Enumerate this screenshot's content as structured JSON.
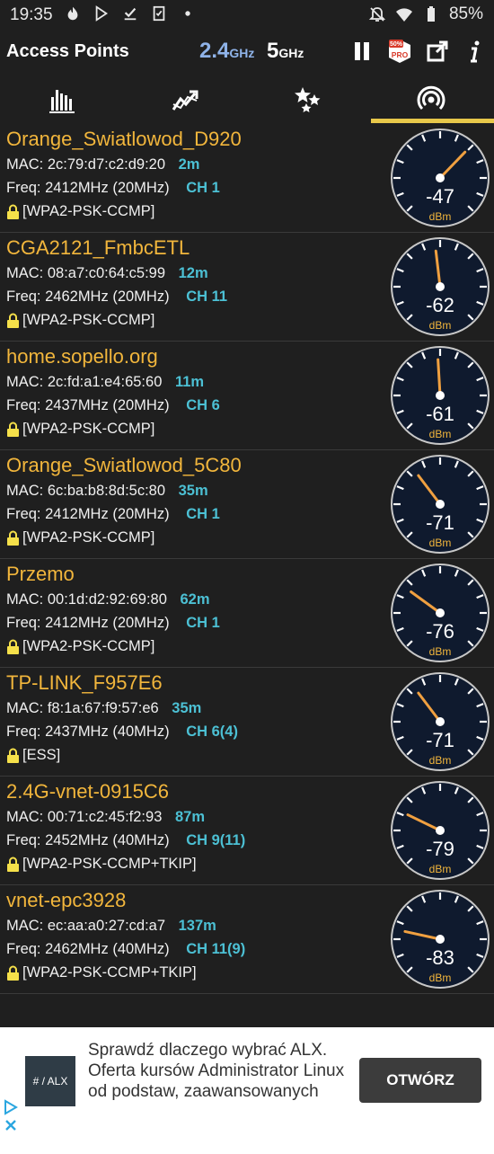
{
  "status_bar": {
    "time": "19:35",
    "battery": "85%",
    "icons_left": [
      "phoenix-icon",
      "play-store-icon",
      "download-done-icon",
      "clipboard-check-icon",
      "dot-icon"
    ],
    "icons_right": [
      "notifications-off-icon",
      "wifi-5-icon",
      "battery-icon"
    ]
  },
  "toolbar": {
    "title": "Access Points",
    "band_24": "2.4",
    "band_24_unit": "GHz",
    "band_5": "5",
    "band_5_unit": "GHz",
    "pro_badge": "50%",
    "pro_label": "PRO",
    "actions": [
      "pause-icon",
      "pro-icon",
      "share-icon",
      "info-icon"
    ]
  },
  "tabs": [
    {
      "name": "channel-rating",
      "icon": "bar-chart-icon"
    },
    {
      "name": "time-graph",
      "icon": "trend-icon"
    },
    {
      "name": "channel-graph",
      "icon": "stars-icon"
    },
    {
      "name": "access-points",
      "icon": "signal-icon",
      "selected": true
    }
  ],
  "access_points": [
    {
      "ssid": "Orange_Swiatlowod_D920",
      "mac_label": "MAC:",
      "mac": "2c:79:d7:c2:d9:20",
      "distance": "2m",
      "freq_label": "Freq:",
      "freq": "2412MHz",
      "width": "(20MHz)",
      "channel": "CH 1",
      "security": "[WPA2-PSK-CCMP]",
      "dbm": "-47",
      "level": -47
    },
    {
      "ssid": "CGA2121_FmbcETL",
      "mac_label": "MAC:",
      "mac": "08:a7:c0:64:c5:99",
      "distance": "12m",
      "freq_label": "Freq:",
      "freq": "2462MHz",
      "width": "(20MHz)",
      "channel": "CH 11",
      "security": "[WPA2-PSK-CCMP]",
      "dbm": "-62",
      "level": -62
    },
    {
      "ssid": "home.sopello.org",
      "mac_label": "MAC:",
      "mac": "2c:fd:a1:e4:65:60",
      "distance": "11m",
      "freq_label": "Freq:",
      "freq": "2437MHz",
      "width": "(20MHz)",
      "channel": "CH 6",
      "security": "[WPA2-PSK-CCMP]",
      "dbm": "-61",
      "level": -61
    },
    {
      "ssid": "Orange_Swiatlowod_5C80",
      "mac_label": "MAC:",
      "mac": "6c:ba:b8:8d:5c:80",
      "distance": "35m",
      "freq_label": "Freq:",
      "freq": "2412MHz",
      "width": "(20MHz)",
      "channel": "CH 1",
      "security": "[WPA2-PSK-CCMP]",
      "dbm": "-71",
      "level": -71
    },
    {
      "ssid": "Przemo",
      "mac_label": "MAC:",
      "mac": "00:1d:d2:92:69:80",
      "distance": "62m",
      "freq_label": "Freq:",
      "freq": "2412MHz",
      "width": "(20MHz)",
      "channel": "CH 1",
      "security": "[WPA2-PSK-CCMP]",
      "dbm": "-76",
      "level": -76
    },
    {
      "ssid": "TP-LINK_F957E6",
      "mac_label": "MAC:",
      "mac": "f8:1a:67:f9:57:e6",
      "distance": "35m",
      "freq_label": "Freq:",
      "freq": "2437MHz",
      "width": "(40MHz)",
      "channel": "CH 6(4)",
      "security": "[ESS]",
      "dbm": "-71",
      "level": -71
    },
    {
      "ssid": "2.4G-vnet-0915C6",
      "mac_label": "MAC:",
      "mac": "00:71:c2:45:f2:93",
      "distance": "87m",
      "freq_label": "Freq:",
      "freq": "2452MHz",
      "width": "(40MHz)",
      "channel": "CH 9(11)",
      "security": "[WPA2-PSK-CCMP+TKIP]",
      "dbm": "-79",
      "level": -79
    },
    {
      "ssid": "vnet-epc3928",
      "mac_label": "MAC:",
      "mac": "ec:aa:a0:27:cd:a7",
      "distance": "137m",
      "freq_label": "Freq:",
      "freq": "2462MHz",
      "width": "(40MHz)",
      "channel": "CH 11(9)",
      "security": "[WPA2-PSK-CCMP+TKIP]",
      "dbm": "-83",
      "level": -83
    }
  ],
  "gauge_unit": "dBm",
  "ad": {
    "logo_text": "# / ALX",
    "text": "Sprawdź dlaczego wybrać ALX. Oferta kursów Administrator Linux od podstaw, zaawansowanych",
    "button": "OTWÓRZ"
  },
  "colors": {
    "ssid": "#f2b63c",
    "accent": "#4cc0d4",
    "needle": "#f0a040",
    "gauge_bg": "#0f1a2e",
    "tab_indicator": "#e8c84a"
  }
}
